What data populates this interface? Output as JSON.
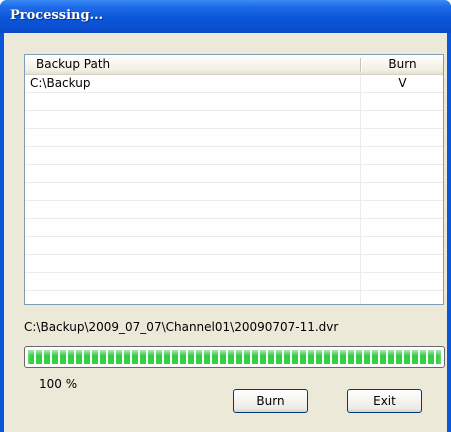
{
  "window": {
    "title": "Processing..."
  },
  "list": {
    "columns": [
      "Backup Path",
      "Burn"
    ],
    "rows": [
      {
        "path": "C:\\Backup",
        "burn": "V"
      }
    ],
    "empty_rows": 12
  },
  "current_file": "C:\\Backup\\2009_07_07\\Channel01\\20090707-11.dvr",
  "progress": {
    "percent_value": 100,
    "percent_text": "100  %",
    "color": "#34d043"
  },
  "buttons": {
    "burn": "Burn",
    "exit": "Exit"
  }
}
